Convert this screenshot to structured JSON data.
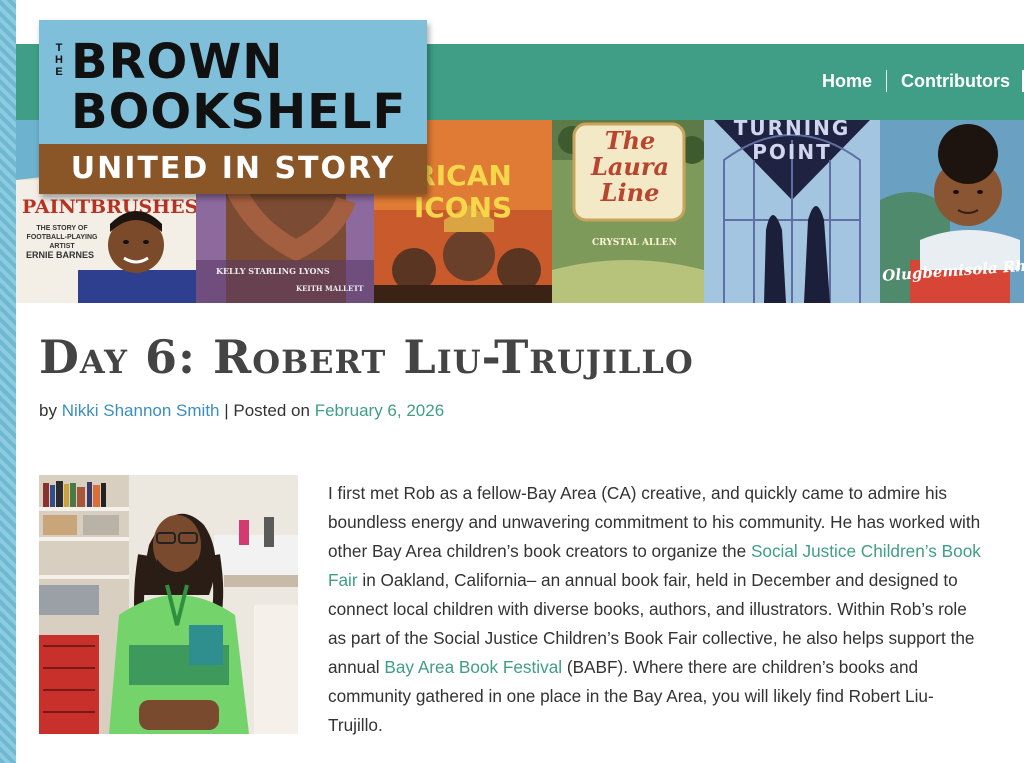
{
  "site": {
    "logo_the": "THE",
    "logo_line1": "BROWN",
    "logo_line2": "BOOKSHELF",
    "logo_tagline": "UNITED IN STORY"
  },
  "nav": {
    "items": [
      "Home",
      "Contributors"
    ]
  },
  "banner_books": [
    {
      "title": "PAINTBRUSHES",
      "subtitle": "THE STORY OF FOOTBALL-PLAYING ARTIST",
      "author": "ERNIE BARNES"
    },
    {
      "title": "",
      "author": "KELLY STARLING LYONS",
      "illustrator": "KEITH MALLETT"
    },
    {
      "title": "RICAN ICONS"
    },
    {
      "title": "The Laura Line",
      "author": "CRYSTAL ALLEN"
    },
    {
      "title": "TURNING POINT"
    },
    {
      "author": "Olugbemisola Rhuday-Perkovi"
    }
  ],
  "post": {
    "title": "Day 6: Robert Liu-Trujillo",
    "by_label": "by",
    "author": "Nikki Shannon Smith",
    "posted_label": "| Posted on",
    "date": "February 6, 2026",
    "paragraph": {
      "t1": "I first met Rob as a fellow-Bay Area (CA) creative, and quickly came to admire his boundless energy and unwavering commitment to his community. He has worked with other Bay Area children’s book creators to organize the ",
      "link1": "Social Justice Children’s Book Fair",
      "t2": " in Oakland, California– an annual book fair, held in December and designed to connect local children with diverse books, authors, and illustrators. Within Rob’s role as part of the Social Justice Children’s Book Fair collective, he also helps support the annual ",
      "link2": "Bay Area Book Festival",
      "t3": " (BABF). Where there are children’s books and community gathered in one place in the Bay Area, you will likely find Robert Liu-Trujillo."
    }
  },
  "colors": {
    "nav_green": "#3f9e85",
    "link_green": "#3f9e85",
    "author_blue": "#3b8ec0",
    "logo_blue": "#7fbfd9",
    "logo_brown": "#8a5527",
    "title_gray": "#444444"
  }
}
